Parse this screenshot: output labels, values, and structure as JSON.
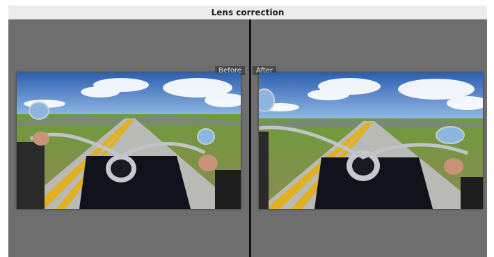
{
  "window": {
    "title": "Lens correction"
  },
  "compare": {
    "before_label": "Before",
    "after_label": "After"
  },
  "colors": {
    "background": "#6e6e6e",
    "title_bar": "#ececec",
    "divider": "#111111",
    "label_bg": "#4a4a4a"
  },
  "photos": {
    "before": {
      "subject": "motorcycle-road-photo",
      "variant": "uncorrected"
    },
    "after": {
      "subject": "motorcycle-road-photo",
      "variant": "lens-corrected"
    }
  }
}
